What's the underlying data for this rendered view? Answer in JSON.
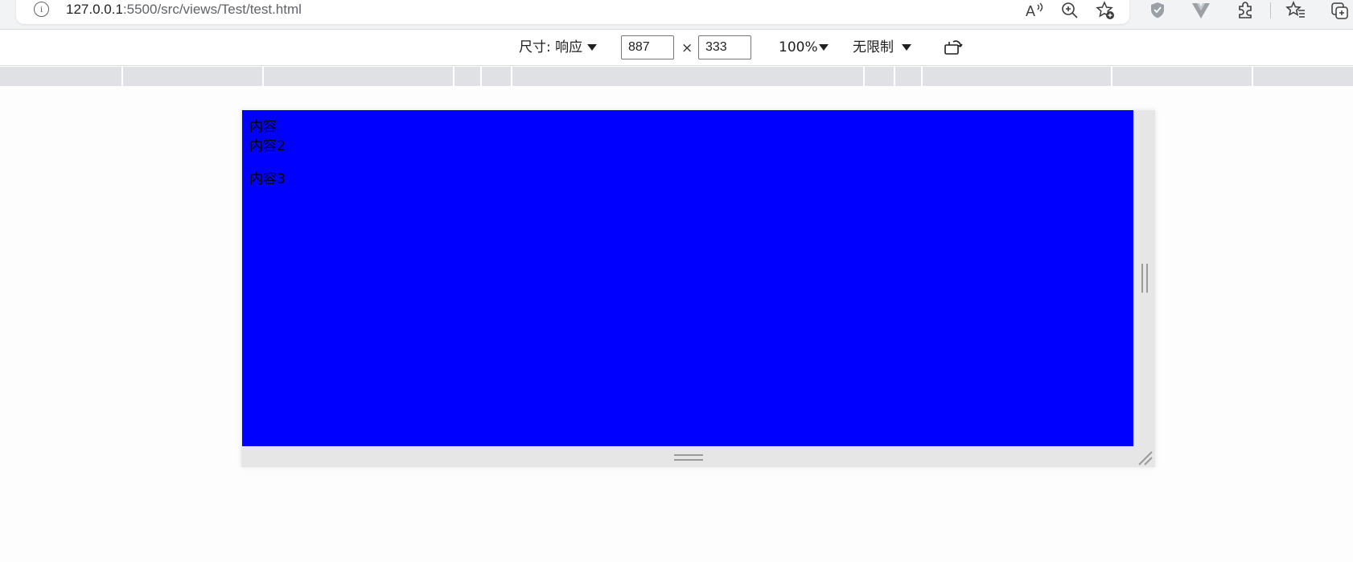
{
  "browser": {
    "url_host": "127.0.0.1",
    "url_path": ":5500/src/views/Test/test.html",
    "toolbar_icons": [
      "read-aloud-icon",
      "zoom-icon",
      "add-favorite-icon",
      "shield-extension-icon",
      "vue-devtools-icon",
      "extensions-icon",
      "favorites-icon",
      "collections-icon"
    ]
  },
  "device_toolbar": {
    "dimensions_label": "尺寸: 响应",
    "width_value": "887",
    "height_value": "333",
    "times_symbol": "×",
    "zoom_label": "100%",
    "throttle_label": "无限制"
  },
  "viewport": {
    "background": "#0000ff",
    "lines": [
      "内容",
      "内容2",
      "内容3"
    ]
  }
}
